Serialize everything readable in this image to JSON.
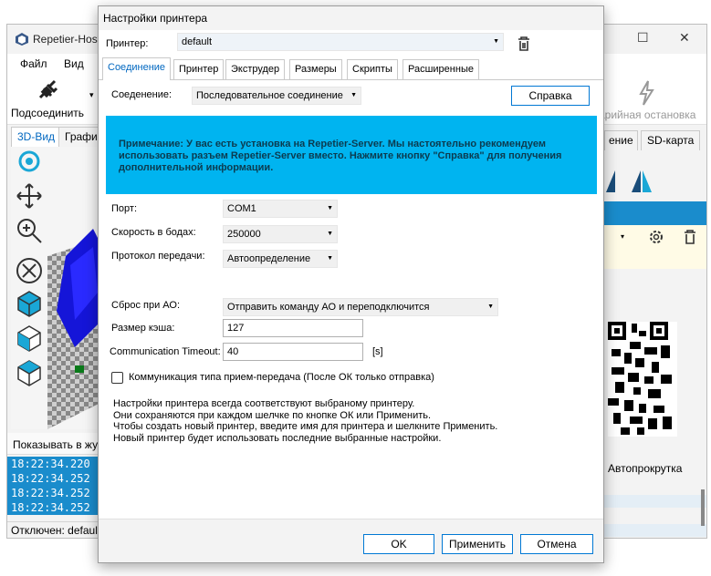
{
  "background_window": {
    "title": "Repetier-Host",
    "menu": [
      "Файл",
      "Вид"
    ],
    "toolbar": {
      "connect_label": "Подсоединить",
      "emergency_label": "Аварийная остановка",
      "emergency_visible": "арийная остановка"
    },
    "tabs_left": [
      "3D-Вид",
      "Графики"
    ],
    "tabs_right": [
      "ение",
      "SD-карта"
    ],
    "log": {
      "show_label": "Показывать в журнале",
      "autoscroll_label": "Автопрокрутка",
      "lines": [
        "18:22:34.220",
        "18:22:34.252",
        "18:22:34.252",
        "18:22:34.252"
      ]
    },
    "status": "Отключен: default"
  },
  "dialog": {
    "title": "Настройки принтера",
    "printer_label": "Принтер:",
    "printer_value": "default",
    "tabs": [
      "Соединение",
      "Принтер",
      "Экструдер",
      "Размеры",
      "Скрипты",
      "Расширенные"
    ],
    "active_tab": "Соединение",
    "connection_label": "Соеденение:",
    "connection_value": "Последовательное соединение",
    "help_button": "Справка",
    "notice": "Примечание: У вас есть установка на Repetier-Server. Мы настоятельно рекомендуем использовать разъем Repetier-Server вместо. Нажмите кнопку \"Справка\" для получения дополнительной информации.",
    "port_label": "Порт:",
    "port_value": "COM1",
    "baud_label": "Скорость в бодах:",
    "baud_value": "250000",
    "protocol_label": "Протокол передачи:",
    "protocol_value": "Автоопределение",
    "reset_label": "Сброс при АО:",
    "reset_value": "Отправить команду АО и переподключится",
    "cache_label": "Размер кэша:",
    "cache_value": "127",
    "timeout_label": "Communication Timeout:",
    "timeout_value": "40",
    "timeout_unit": "[s]",
    "pingpong_label": "Коммуникация типа прием-передача (После ОК только отправка)",
    "info_lines": [
      "Настройки принтера всегда соответствуют выбраному принтеру.",
      "Они сохраняются при каждом шелчке по кнопке ОК или Применить.",
      "Чтобы создать новый принтер, введите имя для принтера и шелкните Применить.",
      "Новый принтер будет использовать последние выбранные настройки."
    ],
    "ok_button": "OK",
    "apply_button": "Применить",
    "cancel_button": "Отмена"
  },
  "colors": {
    "accent": "#0078d4",
    "notice_bg": "#00b4f0",
    "log_bg": "#1a8ccc"
  }
}
